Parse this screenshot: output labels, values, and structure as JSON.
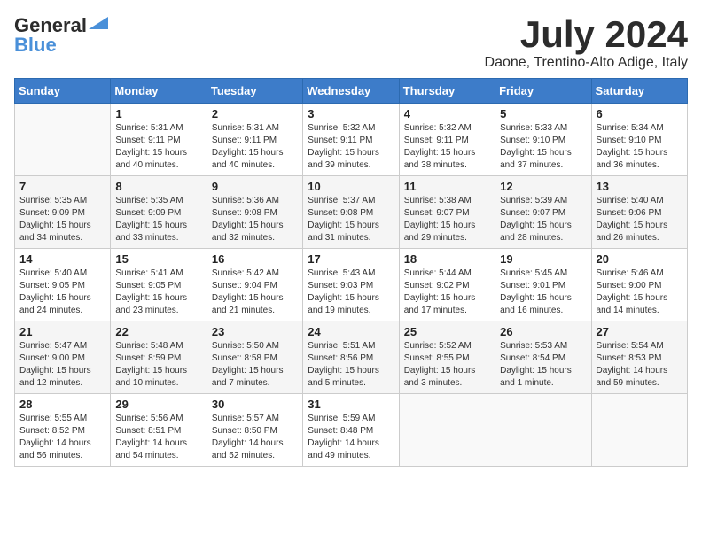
{
  "header": {
    "logo_line1": "General",
    "logo_line2": "Blue",
    "month_title": "July 2024",
    "subtitle": "Daone, Trentino-Alto Adige, Italy"
  },
  "weekdays": [
    "Sunday",
    "Monday",
    "Tuesday",
    "Wednesday",
    "Thursday",
    "Friday",
    "Saturday"
  ],
  "weeks": [
    [
      {
        "day": "",
        "info": ""
      },
      {
        "day": "1",
        "info": "Sunrise: 5:31 AM\nSunset: 9:11 PM\nDaylight: 15 hours\nand 40 minutes."
      },
      {
        "day": "2",
        "info": "Sunrise: 5:31 AM\nSunset: 9:11 PM\nDaylight: 15 hours\nand 40 minutes."
      },
      {
        "day": "3",
        "info": "Sunrise: 5:32 AM\nSunset: 9:11 PM\nDaylight: 15 hours\nand 39 minutes."
      },
      {
        "day": "4",
        "info": "Sunrise: 5:32 AM\nSunset: 9:11 PM\nDaylight: 15 hours\nand 38 minutes."
      },
      {
        "day": "5",
        "info": "Sunrise: 5:33 AM\nSunset: 9:10 PM\nDaylight: 15 hours\nand 37 minutes."
      },
      {
        "day": "6",
        "info": "Sunrise: 5:34 AM\nSunset: 9:10 PM\nDaylight: 15 hours\nand 36 minutes."
      }
    ],
    [
      {
        "day": "7",
        "info": "Sunrise: 5:35 AM\nSunset: 9:09 PM\nDaylight: 15 hours\nand 34 minutes."
      },
      {
        "day": "8",
        "info": "Sunrise: 5:35 AM\nSunset: 9:09 PM\nDaylight: 15 hours\nand 33 minutes."
      },
      {
        "day": "9",
        "info": "Sunrise: 5:36 AM\nSunset: 9:08 PM\nDaylight: 15 hours\nand 32 minutes."
      },
      {
        "day": "10",
        "info": "Sunrise: 5:37 AM\nSunset: 9:08 PM\nDaylight: 15 hours\nand 31 minutes."
      },
      {
        "day": "11",
        "info": "Sunrise: 5:38 AM\nSunset: 9:07 PM\nDaylight: 15 hours\nand 29 minutes."
      },
      {
        "day": "12",
        "info": "Sunrise: 5:39 AM\nSunset: 9:07 PM\nDaylight: 15 hours\nand 28 minutes."
      },
      {
        "day": "13",
        "info": "Sunrise: 5:40 AM\nSunset: 9:06 PM\nDaylight: 15 hours\nand 26 minutes."
      }
    ],
    [
      {
        "day": "14",
        "info": "Sunrise: 5:40 AM\nSunset: 9:05 PM\nDaylight: 15 hours\nand 24 minutes."
      },
      {
        "day": "15",
        "info": "Sunrise: 5:41 AM\nSunset: 9:05 PM\nDaylight: 15 hours\nand 23 minutes."
      },
      {
        "day": "16",
        "info": "Sunrise: 5:42 AM\nSunset: 9:04 PM\nDaylight: 15 hours\nand 21 minutes."
      },
      {
        "day": "17",
        "info": "Sunrise: 5:43 AM\nSunset: 9:03 PM\nDaylight: 15 hours\nand 19 minutes."
      },
      {
        "day": "18",
        "info": "Sunrise: 5:44 AM\nSunset: 9:02 PM\nDaylight: 15 hours\nand 17 minutes."
      },
      {
        "day": "19",
        "info": "Sunrise: 5:45 AM\nSunset: 9:01 PM\nDaylight: 15 hours\nand 16 minutes."
      },
      {
        "day": "20",
        "info": "Sunrise: 5:46 AM\nSunset: 9:00 PM\nDaylight: 15 hours\nand 14 minutes."
      }
    ],
    [
      {
        "day": "21",
        "info": "Sunrise: 5:47 AM\nSunset: 9:00 PM\nDaylight: 15 hours\nand 12 minutes."
      },
      {
        "day": "22",
        "info": "Sunrise: 5:48 AM\nSunset: 8:59 PM\nDaylight: 15 hours\nand 10 minutes."
      },
      {
        "day": "23",
        "info": "Sunrise: 5:50 AM\nSunset: 8:58 PM\nDaylight: 15 hours\nand 7 minutes."
      },
      {
        "day": "24",
        "info": "Sunrise: 5:51 AM\nSunset: 8:56 PM\nDaylight: 15 hours\nand 5 minutes."
      },
      {
        "day": "25",
        "info": "Sunrise: 5:52 AM\nSunset: 8:55 PM\nDaylight: 15 hours\nand 3 minutes."
      },
      {
        "day": "26",
        "info": "Sunrise: 5:53 AM\nSunset: 8:54 PM\nDaylight: 15 hours\nand 1 minute."
      },
      {
        "day": "27",
        "info": "Sunrise: 5:54 AM\nSunset: 8:53 PM\nDaylight: 14 hours\nand 59 minutes."
      }
    ],
    [
      {
        "day": "28",
        "info": "Sunrise: 5:55 AM\nSunset: 8:52 PM\nDaylight: 14 hours\nand 56 minutes."
      },
      {
        "day": "29",
        "info": "Sunrise: 5:56 AM\nSunset: 8:51 PM\nDaylight: 14 hours\nand 54 minutes."
      },
      {
        "day": "30",
        "info": "Sunrise: 5:57 AM\nSunset: 8:50 PM\nDaylight: 14 hours\nand 52 minutes."
      },
      {
        "day": "31",
        "info": "Sunrise: 5:59 AM\nSunset: 8:48 PM\nDaylight: 14 hours\nand 49 minutes."
      },
      {
        "day": "",
        "info": ""
      },
      {
        "day": "",
        "info": ""
      },
      {
        "day": "",
        "info": ""
      }
    ]
  ]
}
